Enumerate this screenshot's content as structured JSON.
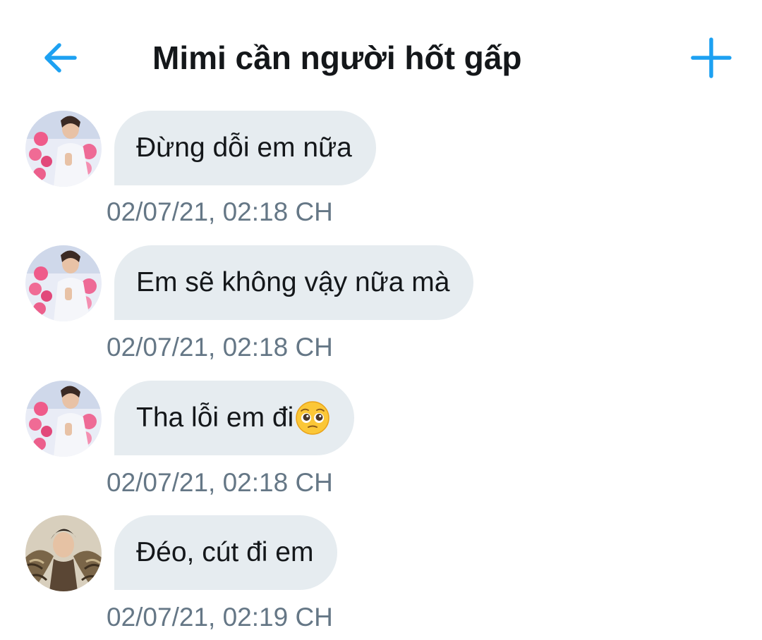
{
  "header": {
    "title": "Mimi cần người hốt gấp",
    "back_icon": "arrow-left-icon",
    "add_icon": "plus-icon",
    "accent_color": "#1da1f2"
  },
  "messages": [
    {
      "text": "Đừng dỗi em nữa",
      "time": "02/07/21, 02:18 CH",
      "avatar": "avatar-flowers"
    },
    {
      "text": "Em sẽ không vậy nữa mà",
      "time": "02/07/21, 02:18 CH",
      "avatar": "avatar-flowers"
    },
    {
      "text": "Tha lỗi em đi",
      "time": "02/07/21, 02:18 CH",
      "avatar": "avatar-flowers",
      "emoji": "pleading-face-emoji"
    },
    {
      "text": "Đéo, cút đi em",
      "time": "02/07/21, 02:19 CH",
      "avatar": "avatar-fur-coat"
    }
  ],
  "colors": {
    "bubble": "#e6ecf0",
    "timestamp": "#657786",
    "text": "#14171a"
  }
}
